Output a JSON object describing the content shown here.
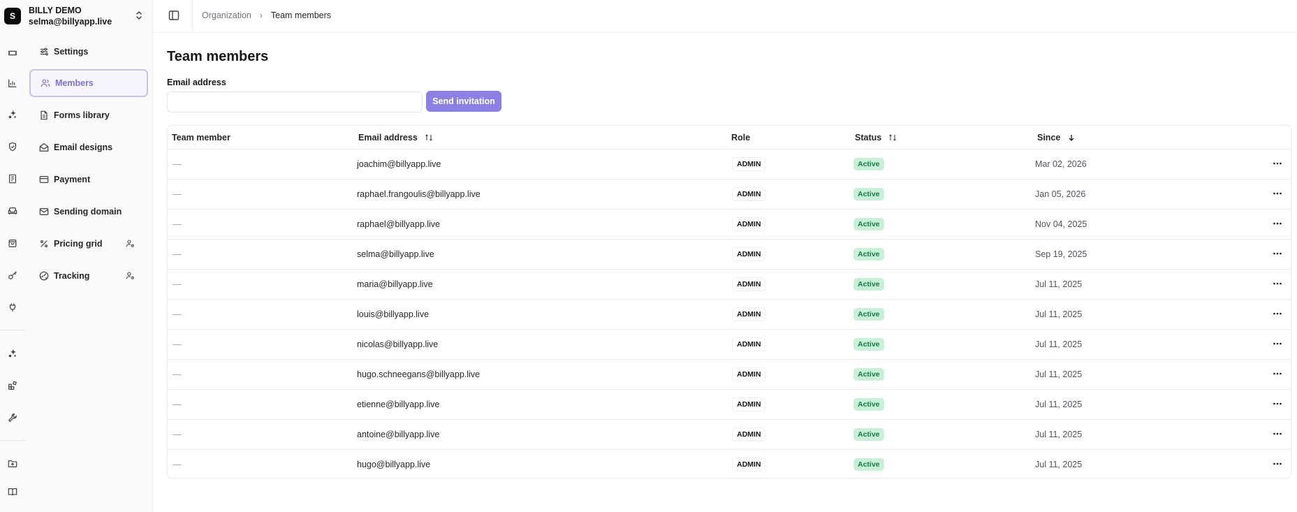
{
  "org": {
    "avatar": "S",
    "name": "BILLY DEMO",
    "email": "selma@billyapp.live"
  },
  "rail_icons": [
    "ticket-icon",
    "chart-icon",
    "sparkle-icon",
    "shield-icon",
    "receipt-icon",
    "sofa-icon",
    "bag-icon",
    "key-icon",
    "plug-icon",
    "sparkle-icon",
    "blocks-icon",
    "wrench-icon",
    "folder-icon",
    "book-icon"
  ],
  "nav": [
    {
      "label": "Settings",
      "icon": "sliders-icon"
    },
    {
      "label": "Members",
      "icon": "users-icon",
      "active": true
    },
    {
      "label": "Forms library",
      "icon": "file-icon"
    },
    {
      "label": "Email designs",
      "icon": "mail-open-icon"
    },
    {
      "label": "Payment",
      "icon": "credit-card-icon"
    },
    {
      "label": "Sending domain",
      "icon": "mail-icon"
    },
    {
      "label": "Pricing grid",
      "icon": "percent-icon",
      "trail": "user-cog-icon"
    },
    {
      "label": "Tracking",
      "icon": "tracking-icon",
      "trail": "user-cog-icon"
    }
  ],
  "breadcrumb": {
    "parent": "Organization",
    "separator": "›",
    "current": "Team members"
  },
  "page_title": "Team members",
  "invite": {
    "label": "Email address",
    "value": "",
    "placeholder": "",
    "button": "Send invitation"
  },
  "table": {
    "headers": {
      "member": "Team member",
      "email": "Email address",
      "role": "Role",
      "status": "Status",
      "since": "Since"
    },
    "rows": [
      {
        "member": "—",
        "email": "joachim@billyapp.live",
        "role": "ADMIN",
        "status": "Active",
        "since": "Mar 02, 2026"
      },
      {
        "member": "—",
        "email": "raphael.frangoulis@billyapp.live",
        "role": "ADMIN",
        "status": "Active",
        "since": "Jan 05, 2026"
      },
      {
        "member": "—",
        "email": "raphael@billyapp.live",
        "role": "ADMIN",
        "status": "Active",
        "since": "Nov 04, 2025"
      },
      {
        "member": "—",
        "email": "selma@billyapp.live",
        "role": "ADMIN",
        "status": "Active",
        "since": "Sep 19, 2025"
      },
      {
        "member": "—",
        "email": "maria@billyapp.live",
        "role": "ADMIN",
        "status": "Active",
        "since": "Jul 11, 2025"
      },
      {
        "member": "—",
        "email": "louis@billyapp.live",
        "role": "ADMIN",
        "status": "Active",
        "since": "Jul 11, 2025"
      },
      {
        "member": "—",
        "email": "nicolas@billyapp.live",
        "role": "ADMIN",
        "status": "Active",
        "since": "Jul 11, 2025"
      },
      {
        "member": "—",
        "email": "hugo.schneegans@billyapp.live",
        "role": "ADMIN",
        "status": "Active",
        "since": "Jul 11, 2025"
      },
      {
        "member": "—",
        "email": "etienne@billyapp.live",
        "role": "ADMIN",
        "status": "Active",
        "since": "Jul 11, 2025"
      },
      {
        "member": "—",
        "email": "antoine@billyapp.live",
        "role": "ADMIN",
        "status": "Active",
        "since": "Jul 11, 2025"
      },
      {
        "member": "—",
        "email": "hugo@billyapp.live",
        "role": "ADMIN",
        "status": "Active",
        "since": "Jul 11, 2025"
      }
    ]
  },
  "colors": {
    "accent": "#8b80e4",
    "active_nav_border": "#c7c2ea",
    "status_bg": "#c8f0d8",
    "status_text": "#177a4a"
  }
}
